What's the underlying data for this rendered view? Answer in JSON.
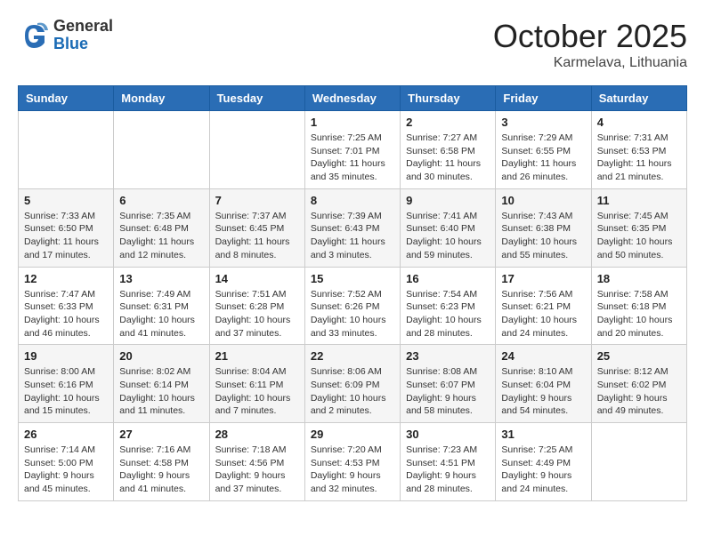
{
  "header": {
    "logo_general": "General",
    "logo_blue": "Blue",
    "month_title": "October 2025",
    "location": "Karmelava, Lithuania"
  },
  "days_of_week": [
    "Sunday",
    "Monday",
    "Tuesday",
    "Wednesday",
    "Thursday",
    "Friday",
    "Saturday"
  ],
  "weeks": [
    [
      {
        "day": "",
        "info": ""
      },
      {
        "day": "",
        "info": ""
      },
      {
        "day": "",
        "info": ""
      },
      {
        "day": "1",
        "info": "Sunrise: 7:25 AM\nSunset: 7:01 PM\nDaylight: 11 hours and 35 minutes."
      },
      {
        "day": "2",
        "info": "Sunrise: 7:27 AM\nSunset: 6:58 PM\nDaylight: 11 hours and 30 minutes."
      },
      {
        "day": "3",
        "info": "Sunrise: 7:29 AM\nSunset: 6:55 PM\nDaylight: 11 hours and 26 minutes."
      },
      {
        "day": "4",
        "info": "Sunrise: 7:31 AM\nSunset: 6:53 PM\nDaylight: 11 hours and 21 minutes."
      }
    ],
    [
      {
        "day": "5",
        "info": "Sunrise: 7:33 AM\nSunset: 6:50 PM\nDaylight: 11 hours and 17 minutes."
      },
      {
        "day": "6",
        "info": "Sunrise: 7:35 AM\nSunset: 6:48 PM\nDaylight: 11 hours and 12 minutes."
      },
      {
        "day": "7",
        "info": "Sunrise: 7:37 AM\nSunset: 6:45 PM\nDaylight: 11 hours and 8 minutes."
      },
      {
        "day": "8",
        "info": "Sunrise: 7:39 AM\nSunset: 6:43 PM\nDaylight: 11 hours and 3 minutes."
      },
      {
        "day": "9",
        "info": "Sunrise: 7:41 AM\nSunset: 6:40 PM\nDaylight: 10 hours and 59 minutes."
      },
      {
        "day": "10",
        "info": "Sunrise: 7:43 AM\nSunset: 6:38 PM\nDaylight: 10 hours and 55 minutes."
      },
      {
        "day": "11",
        "info": "Sunrise: 7:45 AM\nSunset: 6:35 PM\nDaylight: 10 hours and 50 minutes."
      }
    ],
    [
      {
        "day": "12",
        "info": "Sunrise: 7:47 AM\nSunset: 6:33 PM\nDaylight: 10 hours and 46 minutes."
      },
      {
        "day": "13",
        "info": "Sunrise: 7:49 AM\nSunset: 6:31 PM\nDaylight: 10 hours and 41 minutes."
      },
      {
        "day": "14",
        "info": "Sunrise: 7:51 AM\nSunset: 6:28 PM\nDaylight: 10 hours and 37 minutes."
      },
      {
        "day": "15",
        "info": "Sunrise: 7:52 AM\nSunset: 6:26 PM\nDaylight: 10 hours and 33 minutes."
      },
      {
        "day": "16",
        "info": "Sunrise: 7:54 AM\nSunset: 6:23 PM\nDaylight: 10 hours and 28 minutes."
      },
      {
        "day": "17",
        "info": "Sunrise: 7:56 AM\nSunset: 6:21 PM\nDaylight: 10 hours and 24 minutes."
      },
      {
        "day": "18",
        "info": "Sunrise: 7:58 AM\nSunset: 6:18 PM\nDaylight: 10 hours and 20 minutes."
      }
    ],
    [
      {
        "day": "19",
        "info": "Sunrise: 8:00 AM\nSunset: 6:16 PM\nDaylight: 10 hours and 15 minutes."
      },
      {
        "day": "20",
        "info": "Sunrise: 8:02 AM\nSunset: 6:14 PM\nDaylight: 10 hours and 11 minutes."
      },
      {
        "day": "21",
        "info": "Sunrise: 8:04 AM\nSunset: 6:11 PM\nDaylight: 10 hours and 7 minutes."
      },
      {
        "day": "22",
        "info": "Sunrise: 8:06 AM\nSunset: 6:09 PM\nDaylight: 10 hours and 2 minutes."
      },
      {
        "day": "23",
        "info": "Sunrise: 8:08 AM\nSunset: 6:07 PM\nDaylight: 9 hours and 58 minutes."
      },
      {
        "day": "24",
        "info": "Sunrise: 8:10 AM\nSunset: 6:04 PM\nDaylight: 9 hours and 54 minutes."
      },
      {
        "day": "25",
        "info": "Sunrise: 8:12 AM\nSunset: 6:02 PM\nDaylight: 9 hours and 49 minutes."
      }
    ],
    [
      {
        "day": "26",
        "info": "Sunrise: 7:14 AM\nSunset: 5:00 PM\nDaylight: 9 hours and 45 minutes."
      },
      {
        "day": "27",
        "info": "Sunrise: 7:16 AM\nSunset: 4:58 PM\nDaylight: 9 hours and 41 minutes."
      },
      {
        "day": "28",
        "info": "Sunrise: 7:18 AM\nSunset: 4:56 PM\nDaylight: 9 hours and 37 minutes."
      },
      {
        "day": "29",
        "info": "Sunrise: 7:20 AM\nSunset: 4:53 PM\nDaylight: 9 hours and 32 minutes."
      },
      {
        "day": "30",
        "info": "Sunrise: 7:23 AM\nSunset: 4:51 PM\nDaylight: 9 hours and 28 minutes."
      },
      {
        "day": "31",
        "info": "Sunrise: 7:25 AM\nSunset: 4:49 PM\nDaylight: 9 hours and 24 minutes."
      },
      {
        "day": "",
        "info": ""
      }
    ]
  ]
}
